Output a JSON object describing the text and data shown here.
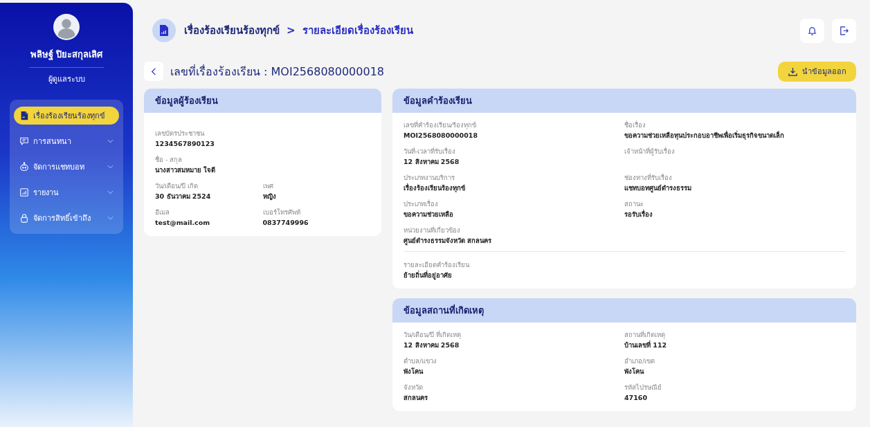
{
  "sidebar": {
    "user_name": "พลิษฐ์ ปิยะสกุลเลิศ",
    "role": "ผู้ดูแลระบบ",
    "menu": [
      {
        "kind": "document",
        "label": "เรื่องร้องเรียนร้องทุกข์",
        "selected": true,
        "expandable": false
      },
      {
        "kind": "chat",
        "label": "การสนทนา",
        "selected": false,
        "expandable": true
      },
      {
        "kind": "robot",
        "label": "จัดการแชทบอท",
        "selected": false,
        "expandable": true
      },
      {
        "kind": "chart",
        "label": "รายงาน",
        "selected": false,
        "expandable": true
      },
      {
        "kind": "lock",
        "label": "จัดการสิทธิ์เข้าถึง",
        "selected": false,
        "expandable": true
      }
    ]
  },
  "breadcrumb": {
    "parent": "เรื่องร้องเรียนร้องทุกข์",
    "separator": ">",
    "current": "รายละเอียดเรื่องร้องเรียน"
  },
  "page_title": "เลขที่เรื่องร้องเรียน : MOI2568080000018",
  "export_button": "นำข้อมูลออก",
  "applicant": {
    "title": "ข้อมูลผู้ร้องเรียน",
    "rows": [
      [
        {
          "label": "เลขบัตรประชาชน",
          "value": "1234567890123"
        }
      ],
      [
        {
          "label": "ชื่อ - สกุล",
          "value": "นางสาวสมหมาย ใจดี"
        }
      ],
      [
        {
          "label": "วัน/เดือน/ปี เกิด",
          "value": "30 ธันวาคม 2524"
        },
        {
          "label": "เพศ",
          "value": "หญิง"
        }
      ],
      [
        {
          "label": "อีเมล",
          "value": "test@mail.com"
        },
        {
          "label": "เบอร์โทรศัพท์",
          "value": "0837749996"
        }
      ]
    ]
  },
  "complaint": {
    "title": "ข้อมูลคำร้องเรียน",
    "rows": [
      [
        {
          "label": "เลขที่คำร้องเรียน/ร้องทุกข์",
          "value": "MOI2568080000018"
        },
        {
          "label": "ชื่อเรื่อง",
          "value": "ขอความช่วยเหลือทุนประกอบอาชีพเพื่อเริ่มธุรกิจขนาดเล็ก"
        }
      ],
      [
        {
          "label": "วันที่-เวลาที่รับเรื่อง",
          "value": "12 สิงหาคม 2568"
        },
        {
          "label": "เจ้าหน้าที่ผู้รับเรื่อง"
        }
      ],
      [
        {
          "label": "ประเภทงานบริการ",
          "value": "เรื่องร้องเรียนร้องทุกข์"
        },
        {
          "label": "ช่องทางที่รับเรื่อง",
          "value": "แชทบอทศูนย์ดำรงธรรม"
        }
      ],
      [
        {
          "label": "ประเภทเรื่อง",
          "value": "ขอความช่วยเหลือ"
        },
        {
          "label": "สถานะ",
          "value": "รอรับเรื่อง"
        }
      ],
      [
        {
          "label": "หน่วยงานที่เกี่ยวข้อง",
          "value": "ศูนย์ดำรงธรรมจังหวัด สกลนคร"
        }
      ]
    ],
    "details": {
      "label": "รายละเอียดคำร้องเรียน",
      "value": "ย้ายถิ่นที่อยู่อาศัย"
    }
  },
  "incident": {
    "title": "ข้อมูลสถานที่เกิดเหตุ",
    "rows": [
      [
        {
          "label": "วัน/เดือน/ปี ที่เกิดเหตุ",
          "value": "12 สิงหาคม 2568"
        },
        {
          "label": "สถานที่เกิดเหตุ",
          "value": "บ้านเลขที่ 112"
        }
      ],
      [
        {
          "label": "ตำบล/แขวง",
          "value": "พังโคน"
        },
        {
          "label": "อำเภอ/เขต",
          "value": "พังโคน"
        }
      ],
      [
        {
          "label": "จังหวัด",
          "value": "สกลนคร"
        },
        {
          "label": "รหัสไปรษณีย์",
          "value": "47160"
        }
      ]
    ]
  }
}
